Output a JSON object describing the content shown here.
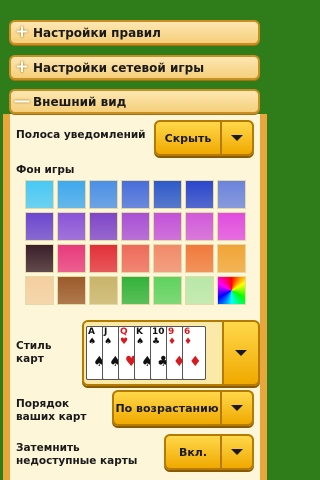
{
  "sections": {
    "rules": {
      "label": "Настройки правил",
      "symbol": "+"
    },
    "network": {
      "label": "Настройки сетевой игры",
      "symbol": "+"
    },
    "appearance": {
      "label": "Внешний вид",
      "symbol": "—"
    }
  },
  "appearance": {
    "notify_bar_label": "Полоса уведомлений",
    "notify_bar_value": "Скрыть",
    "background_label": "Фон игры",
    "swatch_colors": [
      [
        "#48c8f6",
        "#3fa8ee",
        "#4a8fe6",
        "#476ddb",
        "#2e5ac9",
        "#2a46cc",
        "#6b83dc"
      ],
      [
        "#6b47cf",
        "#8a53d9",
        "#7e45c9",
        "#a84fd6",
        "#c352d9",
        "#d05ad9",
        "#e04ce0"
      ],
      [
        "#3a1f29",
        "#e83a7c",
        "#e2303a",
        "#ee6a5a",
        "#f08a6a",
        "#f07a3b",
        "#f0a436"
      ],
      [
        "#f3cfa0",
        "#9c5a2a",
        "#c8b46a",
        "#32b23a",
        "#5ed25e",
        "#b8e8a8",
        "rainbow"
      ]
    ],
    "card_style_label": "Стиль карт",
    "card_order_label": "Порядок ваших карт",
    "card_order_value": "По возрастанию",
    "dim_label": "Затемнить недоступные карты",
    "dim_value": "Вкл.",
    "preview_cards": [
      {
        "rank": "A",
        "suit": "♠",
        "color": "blk"
      },
      {
        "rank": "J",
        "suit": "♠",
        "color": "blk"
      },
      {
        "rank": "Q",
        "suit": "♥",
        "color": "red"
      },
      {
        "rank": "K",
        "suit": "♠",
        "color": "blk"
      },
      {
        "rank": "10",
        "suit": "♣",
        "color": "blk"
      },
      {
        "rank": "9",
        "suit": "♦",
        "color": "red"
      },
      {
        "rank": "6",
        "suit": "♦",
        "color": "red"
      }
    ]
  }
}
